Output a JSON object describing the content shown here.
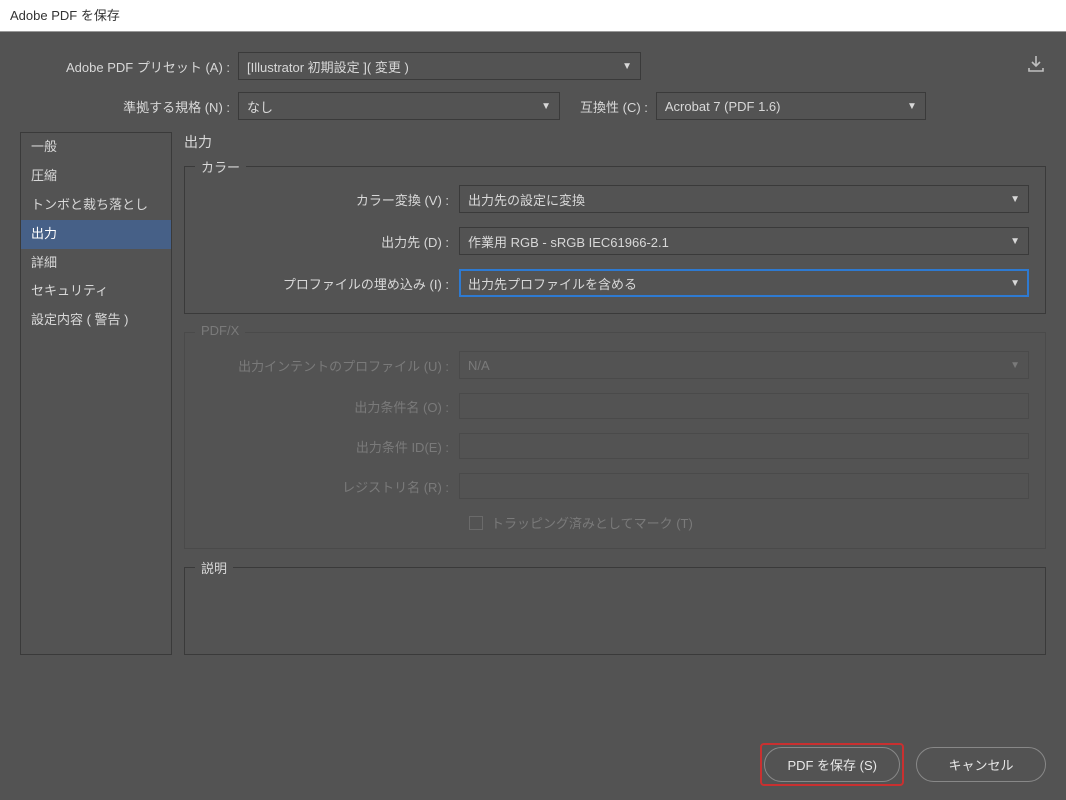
{
  "window": {
    "title": "Adobe PDF を保存"
  },
  "top": {
    "preset_label": "Adobe PDF プリセット (A) :",
    "preset_value": "[Illustrator 初期設定 ]( 変更 )",
    "standard_label": "準拠する規格 (N) :",
    "standard_value": "なし",
    "compat_label": "互換性 (C) :",
    "compat_value": "Acrobat 7 (PDF 1.6)"
  },
  "sidebar": {
    "items": [
      "一般",
      "圧縮",
      "トンボと裁ち落とし",
      "出力",
      "詳細",
      "セキュリティ",
      "設定内容 ( 警告 )"
    ]
  },
  "content": {
    "title": "出力",
    "color": {
      "legend": "カラー",
      "conversion_label": "カラー変換 (V) :",
      "conversion_value": "出力先の設定に変換",
      "destination_label": "出力先 (D) :",
      "destination_value": "作業用 RGB - sRGB IEC61966-2.1",
      "profile_label": "プロファイルの埋め込み (I) :",
      "profile_value": "出力先プロファイルを含める"
    },
    "pdfx": {
      "legend": "PDF/X",
      "intent_label": "出力インテントのプロファイル (U) :",
      "intent_value": "N/A",
      "condition_name_label": "出力条件名 (O) :",
      "condition_name_value": "",
      "condition_id_label": "出力条件 ID(E) :",
      "condition_id_value": "",
      "registry_label": "レジストリ名 (R) :",
      "registry_value": "",
      "trapped_label": "トラッピング済みとしてマーク (T)"
    },
    "desc_legend": "説明"
  },
  "footer": {
    "save": "PDF を保存 (S)",
    "cancel": "キャンセル"
  }
}
